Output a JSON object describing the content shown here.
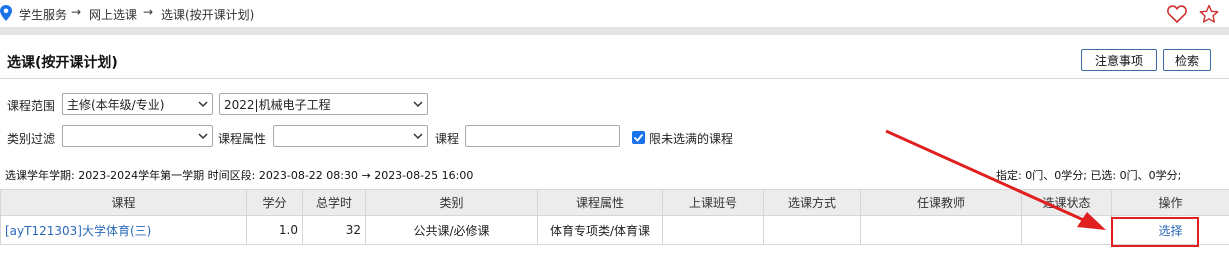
{
  "breadcrumb": {
    "items": [
      "学生服务",
      "网上选课",
      "选课(按开课计划)"
    ],
    "separator": "→"
  },
  "page_title": "选课(按开课计划)",
  "buttons": {
    "notice": "注意事项",
    "search": "检索"
  },
  "filters": {
    "scope_label": "课程范围",
    "scope_value": "主修(本年级/专业)",
    "major_value": "2022|机械电子工程",
    "category_label": "类别过滤",
    "category_value": "",
    "attr_label": "课程属性",
    "attr_value": "",
    "course_label": "课程",
    "course_value": "",
    "limit_label": "限未选满的课程",
    "limit_checked": true
  },
  "info": {
    "term": "选课学年学期: 2023-2024学年第一学期  时间区段: 2023-08-22 08:30 → 2023-08-25 16:00",
    "summary": "指定: 0门、0学分; 已选: 0门、0学分;"
  },
  "table": {
    "headers": [
      "课程",
      "学分",
      "总学时",
      "类别",
      "课程属性",
      "上课班号",
      "选课方式",
      "任课教师",
      "选课状态",
      "操作"
    ],
    "rows": [
      {
        "course": "[ayT121303]大学体育(三)",
        "credit": "1.0",
        "hours": "32",
        "category": "公共课/必修课",
        "attribute": "体育专项类/体育课",
        "class_no": "",
        "method": "",
        "teacher": "",
        "status": "",
        "action": "选择"
      }
    ]
  },
  "colors": {
    "link": "#2a6ab8",
    "annotation": "#e02020",
    "checkbox": "#1a73e8",
    "pin": "#1a73e8"
  },
  "icons": [
    "location-pin-icon",
    "heart-icon",
    "star-icon",
    "chevron-down-icon",
    "checkmark-icon"
  ]
}
